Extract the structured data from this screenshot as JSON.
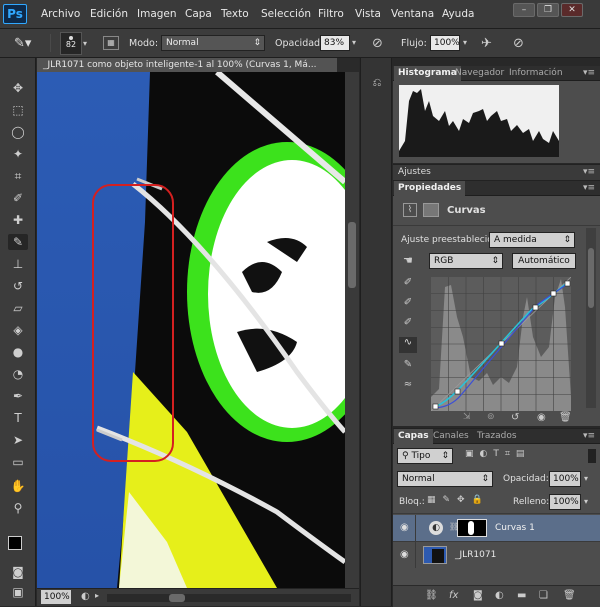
{
  "app": {
    "logo": "Ps"
  },
  "menu": [
    "Archivo",
    "Edición",
    "Imagen",
    "Capa",
    "Texto",
    "Selección",
    "Filtro",
    "Vista",
    "Ventana",
    "Ayuda"
  ],
  "window_controls": [
    "–",
    "❐",
    "✕"
  ],
  "options": {
    "brush_size": "82",
    "mode_label": "Modo:",
    "mode_value": "Normal",
    "opacity_label": "Opacidad:",
    "opacity_value": "83%",
    "flow_label": "Flujo:",
    "flow_value": "100%"
  },
  "document": {
    "tab_title": "_JLR1071 como objeto inteligente-1 al 100% (Curvas 1, Má...",
    "zoom": "100%"
  },
  "panels": {
    "top_tabs": [
      "Histograma",
      "Navegador",
      "Información"
    ],
    "ajustes_tab": "Ajustes",
    "props_tab": "Propiedades",
    "props_title": "Curvas",
    "preset_label": "Ajuste preestablecido:",
    "preset_value": "A medida",
    "channel_value": "RGB",
    "auto_button": "Automático"
  },
  "layers": {
    "tabs": [
      "Capas",
      "Canales",
      "Trazados"
    ],
    "filter_value": "Tipo",
    "blend_value": "Normal",
    "opacity_label": "Opacidad:",
    "opacity_value": "100%",
    "lock_label": "Bloq.:",
    "fill_label": "Relleno:",
    "fill_value": "100%",
    "items": [
      {
        "name": "Curvas 1"
      },
      {
        "name": "_JLR1071"
      }
    ]
  },
  "colors": {
    "accent": "#31a8ff",
    "selection_outline": "#d42020",
    "kite_green": "#3ce21c",
    "kite_yellow": "#e6ef1a"
  }
}
